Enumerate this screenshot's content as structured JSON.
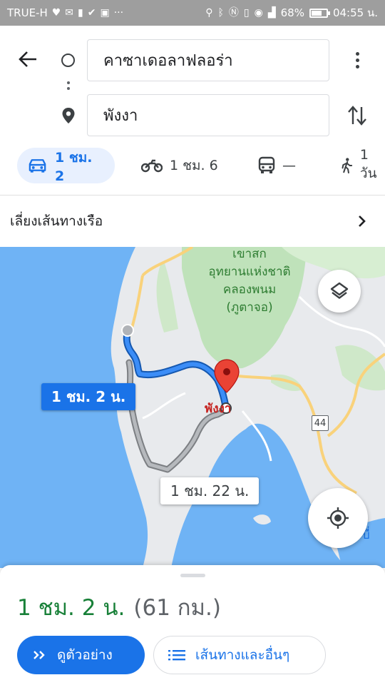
{
  "status_bar": {
    "carrier": "TRUE-H",
    "battery": "68%",
    "battery_level": 0.68,
    "time": "04:55 น.",
    "left_icons": [
      "heart-monitor-icon",
      "mail-icon",
      "battery-saver-icon",
      "check-icon",
      "store-icon",
      "more-icon"
    ],
    "right_icons": [
      "location-icon",
      "bluetooth-icon",
      "nfc-icon",
      "vibrate-icon",
      "eye-icon",
      "signal-icon"
    ]
  },
  "directions": {
    "origin": "คาซาเดอลาฟลอร่า",
    "destination": "พังงา"
  },
  "travel_modes": [
    {
      "name": "car",
      "icon": "car-icon",
      "label": "1 ชม. 2",
      "active": true
    },
    {
      "name": "motorcycle",
      "icon": "motorcycle-icon",
      "label": "1 ชม. 6",
      "active": false
    },
    {
      "name": "transit",
      "icon": "bus-icon",
      "label": "—",
      "active": false
    },
    {
      "name": "walk",
      "icon": "walk-icon",
      "label": "1 วัน",
      "active": false
    }
  ],
  "avoid_ferries": "เลี่ยงเส้นทางเรือ",
  "map": {
    "park_label": [
      "เขาสก",
      "อุทยานแห่งชาติ",
      "คลองพนม",
      "(ภูตาจอ)"
    ],
    "city_label": "พังงา",
    "route_shield": "44",
    "primary_route_time": "1 ชม. 2 น.",
    "alt_route_time": "1 ชม. 22 น.",
    "partial_label": "บี่",
    "colors": {
      "water": "#6fb3f5",
      "land": "#e8eaed",
      "park": "#bfe2ba",
      "route": "#1a73e8",
      "alt_route": "#a8abaf",
      "road": "#f9d27b"
    }
  },
  "summary": {
    "duration": "1 ชม. 2 น.",
    "distance": "(61 กม.)"
  },
  "buttons": {
    "preview": "ดูตัวอย่าง",
    "steps": "เส้นทางและอื่นๆ"
  }
}
